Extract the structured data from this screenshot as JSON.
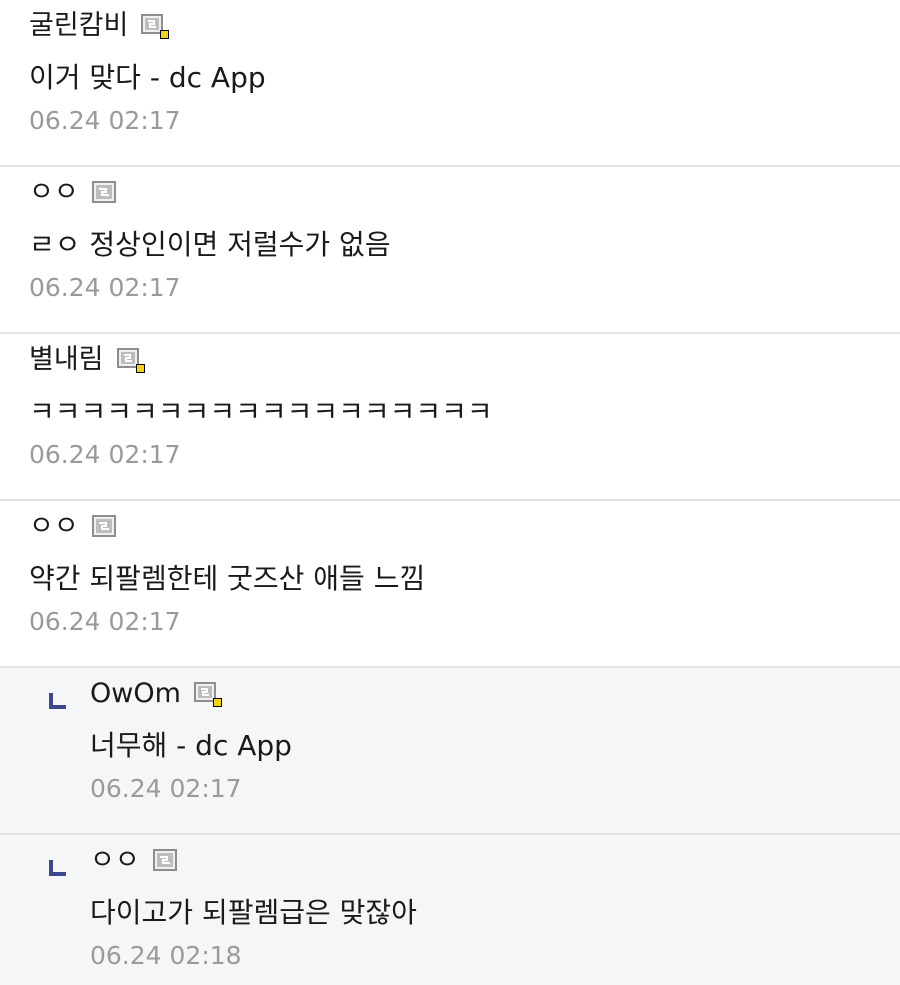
{
  "comments": [
    {
      "nick": "굴린캄비",
      "icon": "gallog-icon-fixed",
      "body": "이거 맞다 - dc App",
      "date": "06.24 02:17",
      "is_reply": false
    },
    {
      "nick": "ㅇㅇ",
      "icon": "gallog-icon",
      "body": "ㄹㅇ 정상인이면 저럴수가 없음",
      "date": "06.24 02:17",
      "is_reply": false
    },
    {
      "nick": "별내림",
      "icon": "gallog-icon-fixed",
      "body": "ㅋㅋㅋㅋㅋㅋㅋㅋㅋㅋㅋㅋㅋㅋㅋㅋㅋㅋ",
      "date": "06.24 02:17",
      "is_reply": false
    },
    {
      "nick": "ㅇㅇ",
      "icon": "gallog-icon",
      "body": "약간 되팔렘한테 굿즈산 애들 느낌",
      "date": "06.24 02:17",
      "is_reply": false
    },
    {
      "nick": "OwOm",
      "icon": "gallog-icon-fixed",
      "body": "너무해 - dc App",
      "date": "06.24 02:17",
      "is_reply": true
    },
    {
      "nick": "ㅇㅇ",
      "icon": "gallog-icon",
      "body": "다이고가 되팔렘급은 맞잖아",
      "date": "06.24 02:18",
      "is_reply": true
    }
  ],
  "colors": {
    "date": "#9a9a9a",
    "reply_bg": "#f5f6f8",
    "reply_arrow": "#3b4890",
    "divider": "#e3e3e3",
    "fixed_dot": "#f2d21b"
  }
}
